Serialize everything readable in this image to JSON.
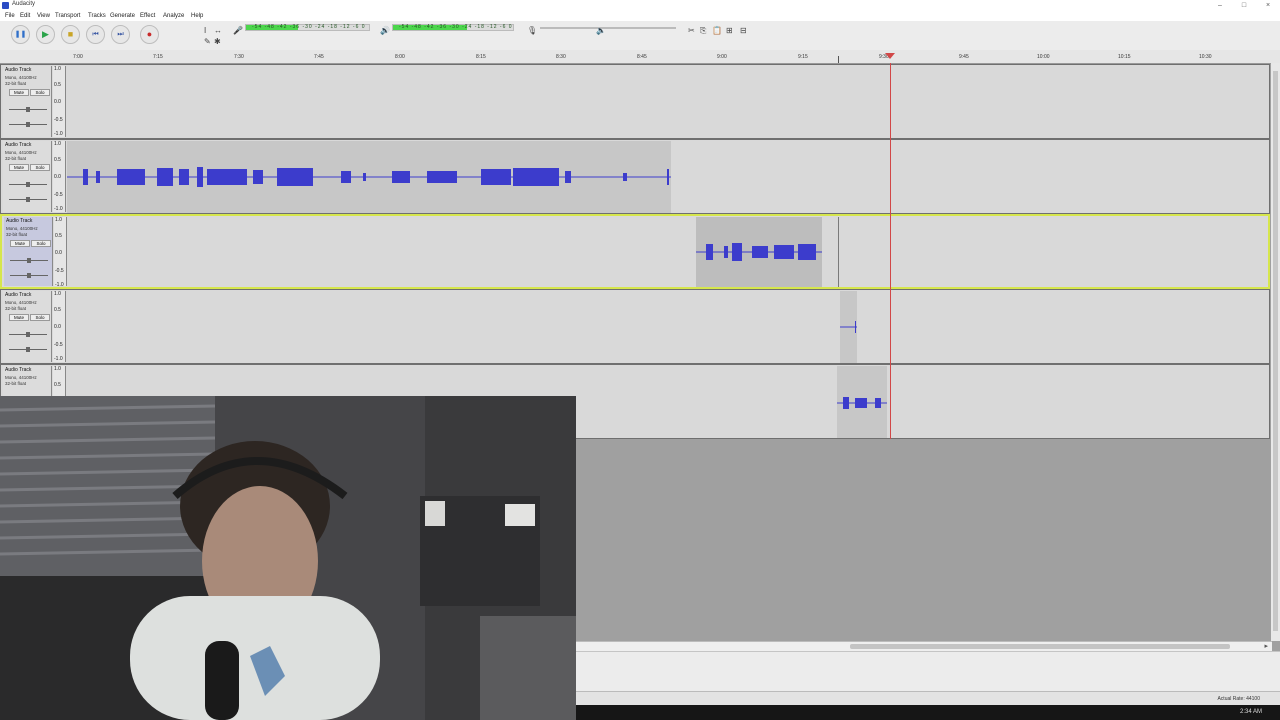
{
  "window": {
    "title": "Audacity",
    "controls": [
      "–",
      "□",
      "×"
    ]
  },
  "menu": [
    "File",
    "Edit",
    "View",
    "Transport",
    "Tracks",
    "Generate",
    "Effect",
    "Analyze",
    "Help"
  ],
  "transport": {
    "buttons": [
      {
        "name": "pause-button",
        "glyph": "❚❚",
        "color": "#2f6fc9"
      },
      {
        "name": "play-button",
        "glyph": "▶",
        "color": "#2aa34a"
      },
      {
        "name": "stop-button",
        "glyph": "■",
        "color": "#c9a526"
      },
      {
        "name": "skip-start-button",
        "glyph": "⏮",
        "color": "#2f4fa0"
      },
      {
        "name": "skip-end-button",
        "glyph": "⏭",
        "color": "#2f4fa0"
      },
      {
        "name": "record-button",
        "glyph": "●",
        "color": "#c82a2a"
      }
    ]
  },
  "meters": {
    "record_scale": "-54 -48 -42 -36 -30 -24 -18 -12 -6 0",
    "play_scale": "-54 -48 -42 -36 -30 -24 -18 -12 -6 0"
  },
  "ruler": {
    "ticks": [
      "7:00",
      "7:15",
      "7:30",
      "7:45",
      "8:00",
      "8:15",
      "8:30",
      "8:45",
      "9:00",
      "9:15",
      "9:30",
      "9:45",
      "10:00",
      "10:15",
      "10:30"
    ]
  },
  "tracks": [
    {
      "name": "Audio Track",
      "info": [
        "Mono, 44100Hz",
        "32-bit float"
      ],
      "mute": "Mute",
      "solo": "Solo",
      "scale": [
        "1.0",
        "0.5",
        "0.0",
        "-0.5",
        "-1.0"
      ],
      "selected": false
    },
    {
      "name": "Audio Track",
      "info": [
        "Mono, 44100Hz",
        "32-bit float"
      ],
      "mute": "Mute",
      "solo": "Solo",
      "scale": [
        "1.0",
        "0.5",
        "0.0",
        "-0.5",
        "-1.0"
      ],
      "selected": false
    },
    {
      "name": "Audio Track",
      "info": [
        "Mono, 44100Hz",
        "32-bit float"
      ],
      "mute": "Mute",
      "solo": "Solo",
      "scale": [
        "1.0",
        "0.5",
        "0.0",
        "-0.5",
        "-1.0"
      ],
      "selected": true
    },
    {
      "name": "Audio Track",
      "info": [
        "Mono, 44100Hz",
        "32-bit float"
      ],
      "mute": "Mute",
      "solo": "Solo",
      "scale": [
        "1.0",
        "0.5",
        "0.0",
        "-0.5",
        "-1.0"
      ],
      "selected": false
    },
    {
      "name": "Audio Track",
      "info": [
        "Mono, 44100Hz",
        "32-bit float"
      ],
      "mute": "Mute",
      "solo": "Solo",
      "scale": [
        "1.0",
        "0.5"
      ],
      "selected": false
    }
  ],
  "status": {
    "actual_rate": "Actual Rate: 44100"
  },
  "taskbar": {
    "clock": "2:34 AM"
  },
  "colors": {
    "waveform": "#3c3ccc",
    "playhead": "#d14747",
    "selected_track_border": "#d6e64c"
  }
}
